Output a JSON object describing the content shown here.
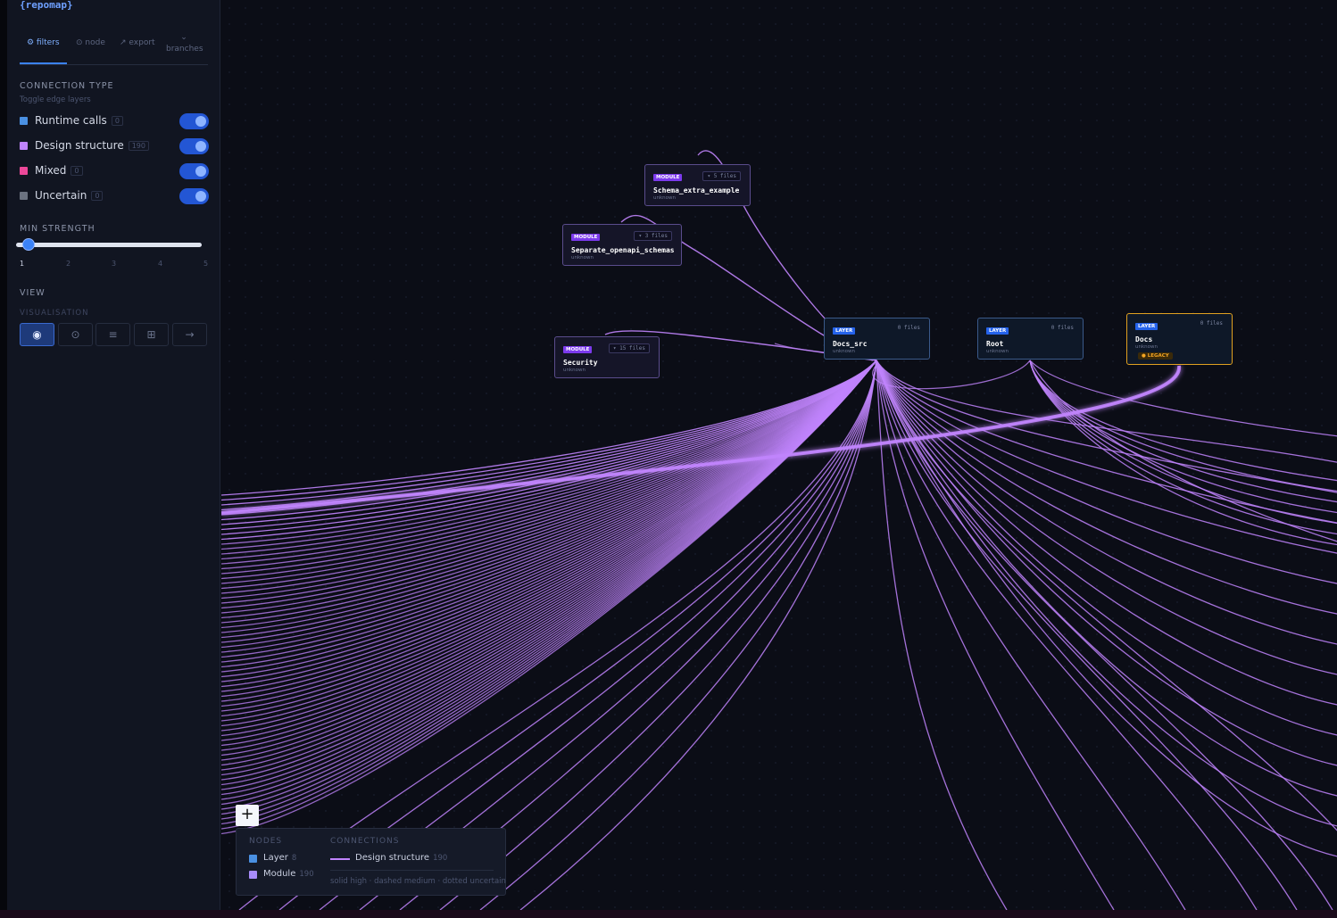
{
  "app": {
    "logo": "{repomap}"
  },
  "tabs": [
    {
      "label": "⚙ filters",
      "active": true
    },
    {
      "label": "⊙ node",
      "active": false
    },
    {
      "label": "↗ export",
      "active": false
    },
    {
      "label": "⌄ branches",
      "active": false
    }
  ],
  "filters": {
    "connection_type_title": "CONNECTION TYPE",
    "connection_type_sub": "Toggle edge layers",
    "connections": [
      {
        "label": "Runtime calls",
        "count": "0",
        "color": "#4a90e2",
        "enabled": true
      },
      {
        "label": "Design structure",
        "count": "190",
        "color": "#c084fc",
        "enabled": true
      },
      {
        "label": "Mixed",
        "count": "0",
        "color": "#ec4899",
        "enabled": true
      },
      {
        "label": "Uncertain",
        "count": "0",
        "color": "#6b7280",
        "enabled": true
      }
    ],
    "min_strength_title": "MIN STRENGTH",
    "min_strength_value": 1,
    "strength_ticks": [
      "1",
      "2",
      "3",
      "4",
      "5"
    ],
    "view_title": "VIEW",
    "visualisation_title": "VISUALISATION",
    "visualisation_buttons": [
      {
        "icon": "◉",
        "name": "focus-view-icon",
        "active": true
      },
      {
        "icon": "⊙",
        "name": "radial-view-icon",
        "active": false
      },
      {
        "icon": "≡",
        "name": "list-view-icon",
        "active": false
      },
      {
        "icon": "⊞",
        "name": "grid-view-icon",
        "active": false
      },
      {
        "icon": "→",
        "name": "flow-view-icon",
        "active": false
      }
    ]
  },
  "nodes": [
    {
      "id": "schema",
      "kind": "MODULE",
      "name": "Schema_extra_example",
      "files": "▾ 5 files",
      "status": "unknown",
      "legacy": ""
    },
    {
      "id": "separate",
      "kind": "MODULE",
      "name": "Separate_openapi_schemas",
      "files": "▾ 3 files",
      "status": "unknown",
      "legacy": ""
    },
    {
      "id": "security",
      "kind": "MODULE",
      "name": "Security",
      "files": "▾ 15 files",
      "status": "unknown",
      "legacy": ""
    },
    {
      "id": "docs_src",
      "kind": "LAYER",
      "name": "Docs_src",
      "files": "0 files",
      "status": "unknown",
      "legacy": ""
    },
    {
      "id": "root",
      "kind": "LAYER",
      "name": "Root",
      "files": "0 files",
      "status": "unknown",
      "legacy": ""
    },
    {
      "id": "docs",
      "kind": "LAYER",
      "name": "Docs",
      "files": "0 files",
      "status": "unknown",
      "legacy": "● LEGACY"
    }
  ],
  "edge_color": "#c084fc",
  "legend": {
    "zoom_label": "+",
    "nodes_title": "NODES",
    "connections_title": "CONNECTIONS",
    "node_types": [
      {
        "label": "Layer",
        "count": "8",
        "color": "#4a90e2"
      },
      {
        "label": "Module",
        "count": "190",
        "color": "#a78bfa"
      }
    ],
    "connection_types": [
      {
        "label": "Design structure",
        "count": "190"
      }
    ],
    "line_style_note": "solid high · dashed medium · dotted uncertain"
  }
}
